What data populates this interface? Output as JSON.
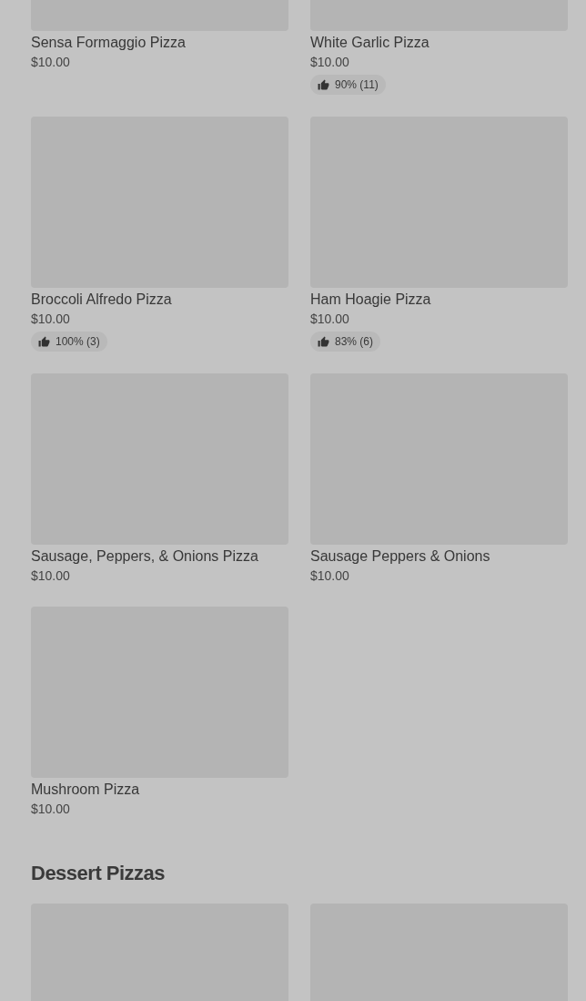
{
  "sections": [
    {
      "items": [
        {
          "kind": "card",
          "name": "Sensa Formaggio Pizza",
          "price": "$10.00"
        },
        {
          "kind": "card",
          "name": "White Garlic Pizza",
          "price": "$10.00",
          "rating": "90% (11)"
        },
        {
          "kind": "card",
          "name": "Broccoli Alfredo Pizza",
          "price": "$10.00",
          "rating": "100% (3)"
        },
        {
          "kind": "card",
          "name": "Ham Hoagie Pizza",
          "price": "$10.00",
          "rating": "83% (6)"
        },
        {
          "kind": "card",
          "name": "Sausage, Peppers, & Onions Pizza",
          "price": "$10.00"
        },
        {
          "kind": "card",
          "name": "Sausage Peppers & Onions",
          "price": "$10.00"
        },
        {
          "kind": "card",
          "name": "Mushroom Pizza",
          "price": "$10.00"
        }
      ]
    },
    {
      "title": "Dessert Pizzas",
      "items": [
        {
          "kind": "image_only"
        },
        {
          "kind": "image_only"
        }
      ]
    }
  ]
}
